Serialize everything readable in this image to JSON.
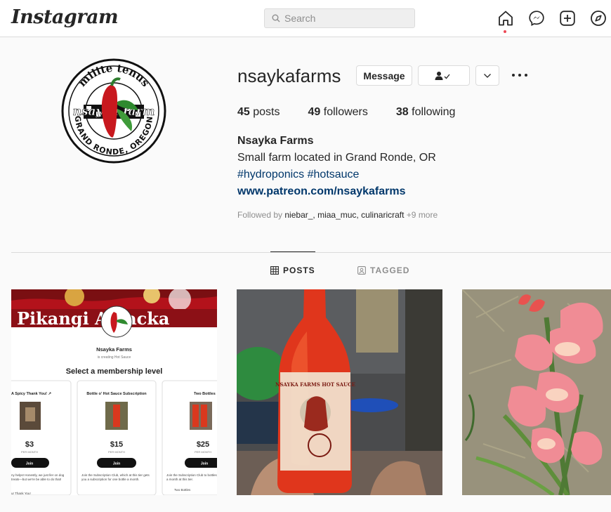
{
  "header": {
    "logo": "Instagram",
    "search_placeholder": "Search",
    "icons": [
      "home-icon",
      "messenger-icon",
      "new-post-icon",
      "explore-icon"
    ]
  },
  "profile": {
    "username": "nsaykafarms",
    "message_label": "Message",
    "stats": {
      "posts_count": "45",
      "posts_label": "posts",
      "followers_count": "49",
      "followers_label": "followers",
      "following_count": "38",
      "following_label": "following"
    },
    "bio": {
      "name": "Nsayka Farms",
      "description": "Small farm located in Grand Ronde, OR",
      "hashtags": "#hydroponics #hotsauce",
      "link": "www.patreon.com/nsaykafarms"
    },
    "followed_by": {
      "prefix": "Followed by",
      "names": "niebar_, miaa_muc, culinaricraft",
      "more": "+9 more"
    },
    "avatar_logo": {
      "top_text": "milite tenus",
      "mid_text": "nsayka farm",
      "bottom_text": "GRAND RONDE, OREGON"
    }
  },
  "tabs": {
    "posts": "POSTS",
    "tagged": "TAGGED"
  },
  "posts": [
    {
      "banner": "Pikangi Amacka",
      "title": "Nsayka Farms",
      "subtitle": "is creating Hot Sauce",
      "heading": "Select a membership level",
      "tiers": [
        {
          "name": "A Spicy Thank You! ↗",
          "price": "$3",
          "per": "PER MONTH",
          "button": "Join",
          "desc": "ny helps! Honestly, we just ller on dog treats—but we're be able to do that!",
          "extra": "ur Thank You!"
        },
        {
          "name": "Bottle o' Hot Sauce Subscription",
          "price": "$15",
          "per": "PER MONTH",
          "button": "Join",
          "desc": "Join the Subscription Club, which at this tier gets you a subscription for one bottle a month.",
          "extra": ""
        },
        {
          "name": "Two Bottles",
          "price": "$25",
          "per": "PER MONTH",
          "button": "Join",
          "desc": "Join the Subscription Club to bottles a month at this tier.",
          "extra": "Two Bottles"
        }
      ]
    },
    {
      "label_text": "NSAYKA FARMS HOT SAUCE"
    },
    {
      "description": ""
    }
  ],
  "colors": {
    "link": "#00376b",
    "notification": "#ed4956",
    "border": "#dbdbdb",
    "muted": "#8e8e8e",
    "text": "#262626"
  }
}
